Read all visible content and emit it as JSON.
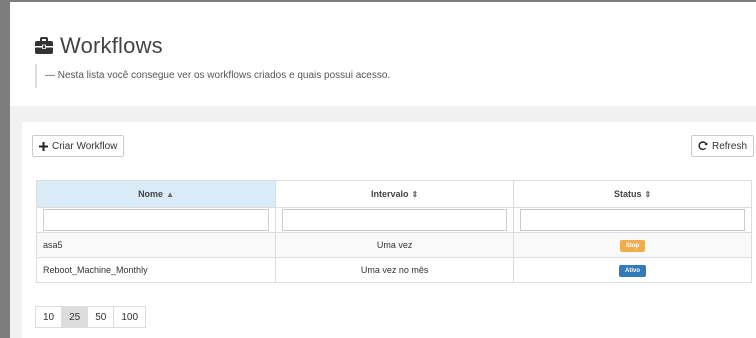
{
  "header": {
    "title": "Workflows",
    "description": "— Nesta lista você consegue ver os workflows criados e quais possui acesso."
  },
  "toolbar": {
    "create_label": "Criar Workflow",
    "refresh_label": "Refresh"
  },
  "table": {
    "columns": [
      {
        "label": "Nome",
        "sort": "▲",
        "sorted": true
      },
      {
        "label": "Intervalo",
        "sort": "⇕",
        "sorted": false
      },
      {
        "label": "Status",
        "sort": "⇕",
        "sorted": false
      }
    ],
    "filters": [
      "",
      "",
      ""
    ],
    "rows": [
      {
        "name": "asa5",
        "interval": "Uma vez",
        "status": "Stop",
        "status_color": "#f0ad4e"
      },
      {
        "name": "Reboot_Machine_Monthly",
        "interval": "Uma vez no mês",
        "status": "Ativo",
        "status_color": "#337ab7"
      }
    ]
  },
  "pagination": {
    "sizes": [
      "10",
      "25",
      "50",
      "100"
    ],
    "selected": "25"
  },
  "colors": {
    "frame": "#7d7d7d",
    "sorted_header": "#d9ebf7"
  },
  "icons": {
    "title": "briefcase-icon",
    "create": "plus-icon",
    "refresh": "refresh-icon"
  }
}
